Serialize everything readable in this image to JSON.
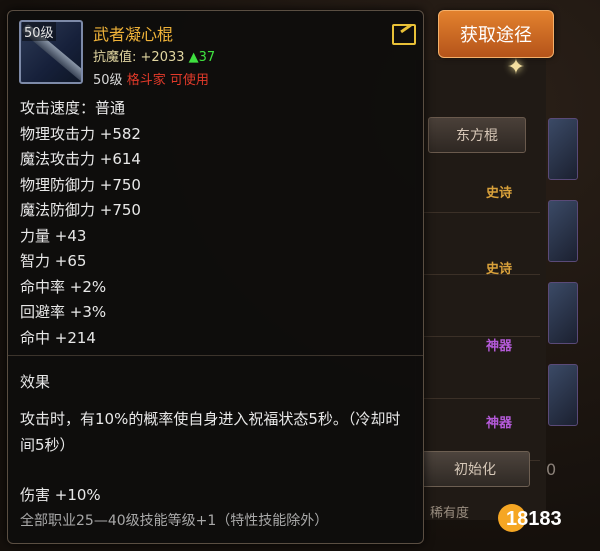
{
  "item": {
    "level_badge": "50级",
    "name": "武者凝心棍",
    "resist_label": "抗魔值:",
    "resist_value": "+2033",
    "resist_delta": "▲37",
    "req_level": "50级",
    "req_class": "格斗家 可使用"
  },
  "stats": [
    "攻击速度：普通",
    "物理攻击力 +582",
    "魔法攻击力 +614",
    "物理防御力 +750",
    "魔法防御力 +750",
    "力量 +43",
    "智力 +65",
    "命中率 +2%",
    "回避率 +3%",
    "命中 +214"
  ],
  "effect": {
    "title": "效果",
    "description": "攻击时，有10%的概率使自身进入祝福状态5秒。（冷却时间5秒）",
    "damage": "伤害 +10%",
    "skill_bonus": "全部职业25—40级技能等级+1（特性技能除外）"
  },
  "background": {
    "obtain_button": "获取途径",
    "class_button": "东方棍",
    "tags": [
      "史诗",
      "史诗",
      "神器",
      "神器"
    ],
    "initialize_button": "初始化",
    "rarity_label": "稀有度",
    "partial_number": "0",
    "logo": "18183"
  },
  "colors": {
    "item_name": "#f0b339",
    "resist_up": "#3fe03f",
    "class_restriction": "#e23a2a",
    "obtain_button": "#d06a24",
    "tag_epic": "#d9a13b",
    "tag_legendary": "#b45ad8"
  },
  "icons": [
    "item-staff-icon",
    "share-icon",
    "star-sparkle-icon"
  ]
}
